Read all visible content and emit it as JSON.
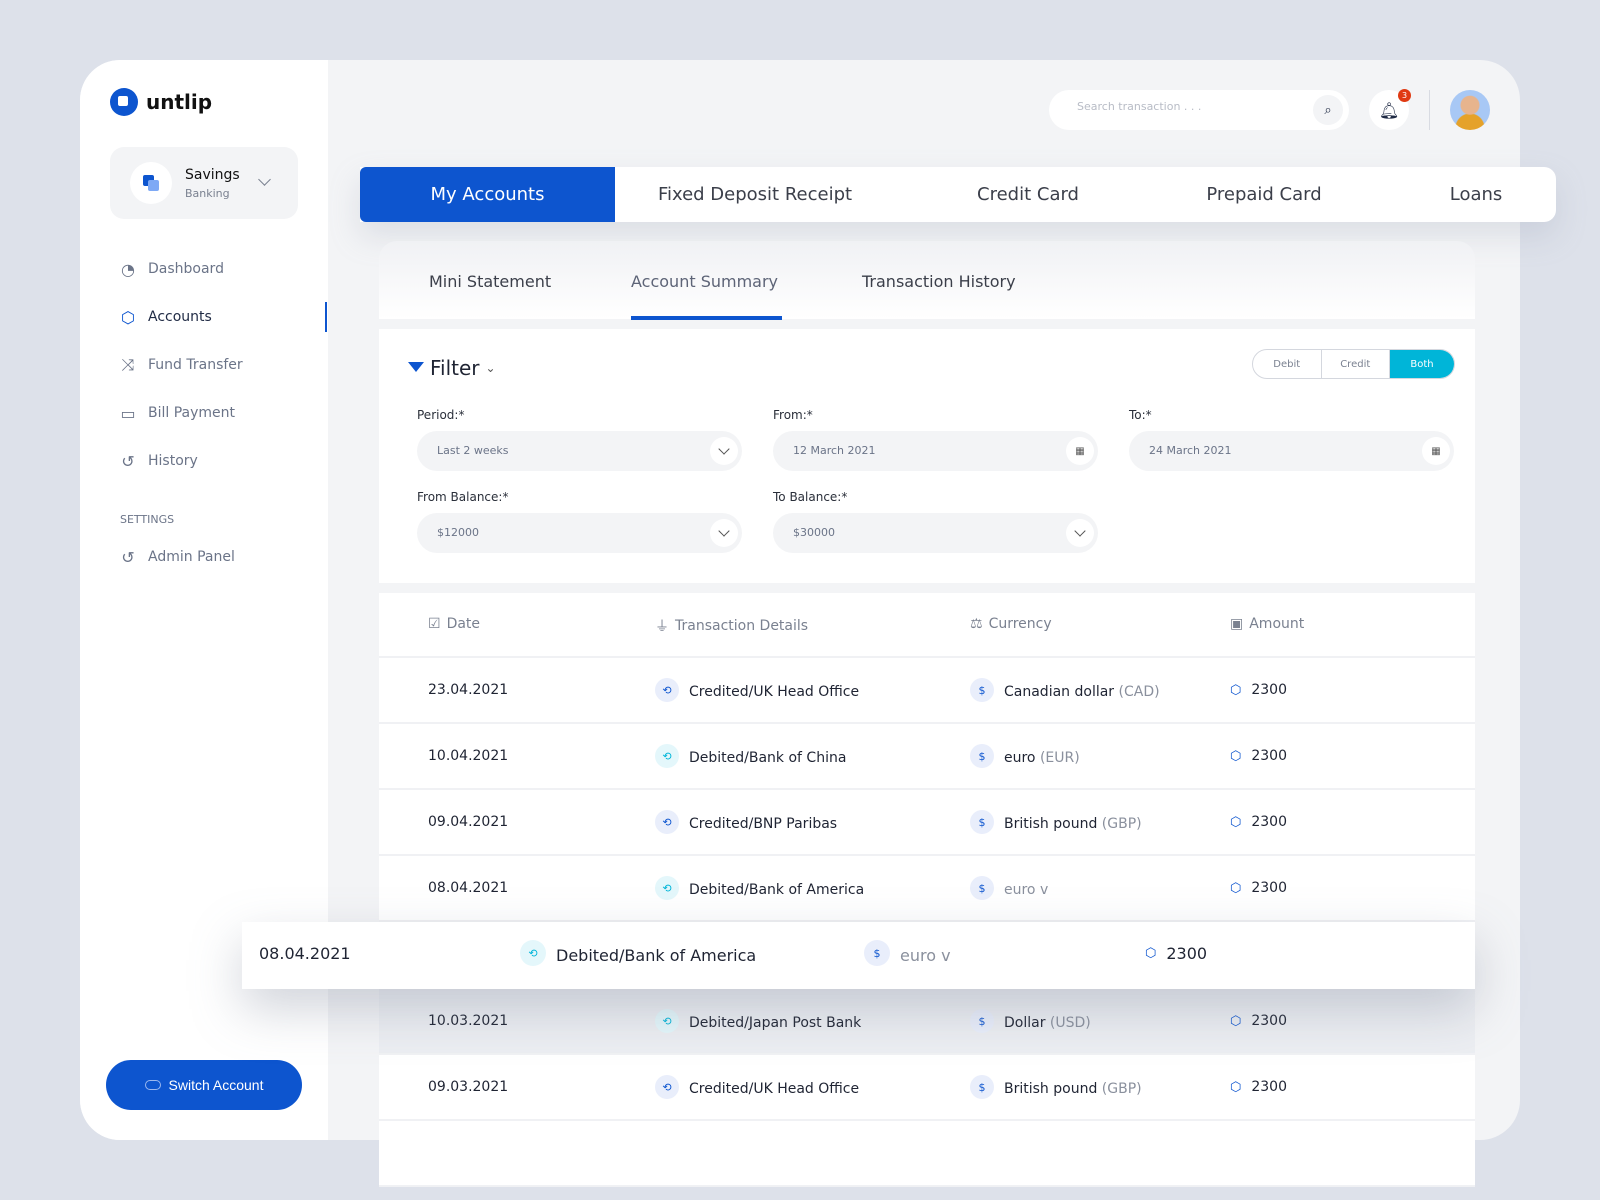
{
  "brand": {
    "name": "untlip",
    "accent": "#0d55cf",
    "secondary": "#00b5d8"
  },
  "account_switcher": {
    "title": "Savings",
    "subtitle": "Banking"
  },
  "sidebar": {
    "items": [
      {
        "label": "Dashboard",
        "icon": "gauge-icon",
        "active": false
      },
      {
        "label": "Accounts",
        "icon": "piggy-bank-icon",
        "active": true
      },
      {
        "label": "Fund Transfer",
        "icon": "shuffle-icon",
        "active": false
      },
      {
        "label": "Bill Payment",
        "icon": "wallet-icon",
        "active": false
      },
      {
        "label": "History",
        "icon": "history-icon",
        "active": false
      }
    ],
    "settings_label": "SETTINGS",
    "settings_items": [
      {
        "label": "Admin Panel",
        "icon": "history-icon"
      }
    ],
    "switch_label": "Switch Account"
  },
  "header": {
    "search_placeholder": "Search transaction . . .",
    "notification_count": "3"
  },
  "tabs": [
    {
      "label": "My Accounts",
      "active": true
    },
    {
      "label": "Fixed Deposit Receipt"
    },
    {
      "label": "Credit Card"
    },
    {
      "label": "Prepaid Card"
    },
    {
      "label": "Loans"
    }
  ],
  "subtabs": [
    {
      "label": "Mini Statement"
    },
    {
      "label": "Account Summary",
      "active": true
    },
    {
      "label": "Transaction History"
    }
  ],
  "filter": {
    "title": "Filter",
    "types": [
      "Debit",
      "Credit",
      "Both"
    ],
    "selected_type": "Both",
    "period": {
      "label": "Period:*",
      "value": "Last 2 weeks"
    },
    "from": {
      "label": "From:*",
      "value": "12 March 2021"
    },
    "to": {
      "label": "To:*",
      "value": "24 March 2021"
    },
    "from_balance": {
      "label": "From Balance:*",
      "value": "$12000"
    },
    "to_balance": {
      "label": "To Balance:*",
      "value": "$30000"
    }
  },
  "table": {
    "columns": [
      "Date",
      "Transaction Details",
      "Currency",
      "Amount"
    ],
    "rows": [
      {
        "date": "23.04.2021",
        "details": "Credited/UK Head Office",
        "type": "credit",
        "currency": "Canadian dollar",
        "code": "(CAD)",
        "amount": "2300"
      },
      {
        "date": "10.04.2021",
        "details": "Debited/Bank of China",
        "type": "debit",
        "currency": "euro",
        "code": "(EUR)",
        "amount": "2300"
      },
      {
        "date": "09.04.2021",
        "details": "Credited/BNP Paribas",
        "type": "credit",
        "currency": "British pound",
        "code": "(GBP)",
        "amount": "2300"
      },
      {
        "date": "08.04.2021",
        "details": "Debited/Bank of America",
        "type": "debit",
        "currency": "",
        "code": "euro v",
        "amount": "2300"
      },
      {
        "date": "08.04.2021",
        "details": "Debited/Bank of America",
        "type": "debit",
        "currency": "",
        "code": "euro v",
        "amount": "2300",
        "highlighted": true
      },
      {
        "date": "10.03.2021",
        "details": "Debited/Japan Post Bank",
        "type": "debit",
        "currency": "Dollar",
        "code": "(USD)",
        "amount": "2300"
      },
      {
        "date": "09.03.2021",
        "details": "Credited/UK Head Office",
        "type": "credit",
        "currency": "British pound",
        "code": "(GBP)",
        "amount": "2300"
      }
    ]
  }
}
